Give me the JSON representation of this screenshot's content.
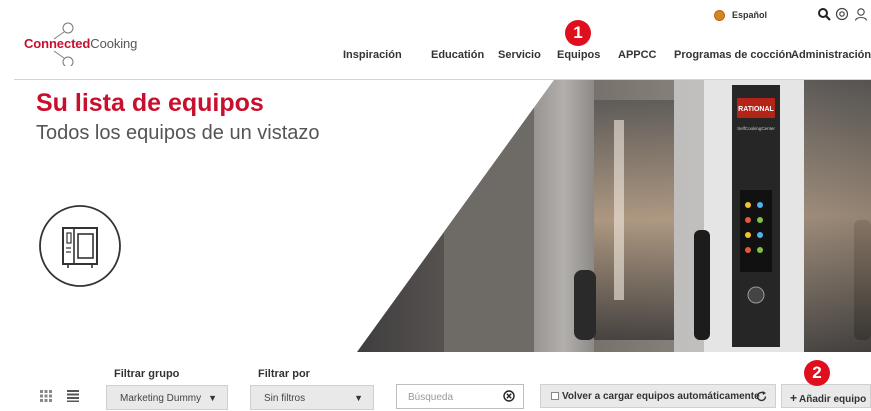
{
  "logo": {
    "part1": "Connected",
    "part2": "Cooking"
  },
  "topbar": {
    "language": "Español",
    "icons": [
      "search-icon",
      "settings-icon",
      "user-icon"
    ]
  },
  "nav": {
    "items": [
      {
        "label": "Inspiración"
      },
      {
        "label": "Educatión"
      },
      {
        "label": "Servicio"
      },
      {
        "label": "Equipos"
      },
      {
        "label": "APPCC"
      },
      {
        "label": "Programas de cocción"
      },
      {
        "label": "Administración"
      }
    ]
  },
  "badges": {
    "one": "1",
    "two": "2"
  },
  "hero": {
    "title": "Su lista de equipos",
    "subtitle": "Todos los equipos de un vistazo",
    "icon": "combi-oven-icon",
    "photo_brand": "RATIONAL",
    "photo_model": "SelfCookingCenter"
  },
  "filters": {
    "group_label": "Filtrar grupo",
    "group_value": "Marketing Dummy",
    "filter_label": "Filtrar por",
    "filter_value": "Sin filtros",
    "search_placeholder": "Búsqueda",
    "reload_label": "Volver a cargar equipos automáticamente",
    "add_label": "Añadir equipo",
    "view_icons": [
      "grid-view-icon",
      "list-view-icon"
    ]
  },
  "colors": {
    "brand_red": "#c8102e",
    "badge_red": "#e00f1d"
  }
}
